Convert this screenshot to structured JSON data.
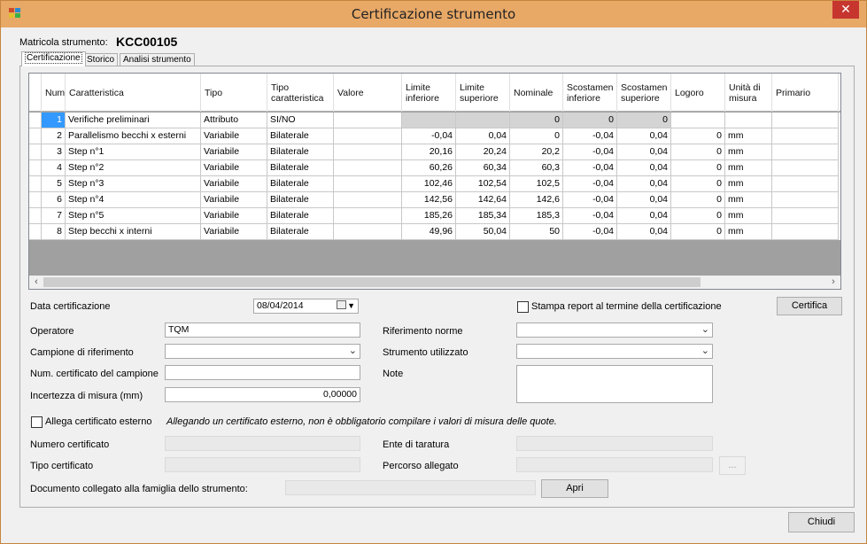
{
  "window": {
    "title": "Certificazione strumento",
    "close_glyph": "✕"
  },
  "matricola": {
    "label": "Matricola strumento:",
    "value": "KCC00105"
  },
  "tabs": [
    "Certificazione",
    "Storico",
    "Analisi strumento"
  ],
  "grid": {
    "headers": {
      "num": "Num",
      "caratteristica": "Caratteristica",
      "tipo": "Tipo",
      "tipo_caratteristica": "Tipo caratteristica",
      "valore": "Valore",
      "limite_inferiore": "Limite inferiore",
      "limite_superiore": "Limite superiore",
      "nominale": "Nominale",
      "scostamento_inferiore": "Scostamen inferiore",
      "scostamento_superiore": "Scostamen superiore",
      "logoro": "Logoro",
      "unita_misura": "Unità di misura",
      "primario": "Primario"
    },
    "rows": [
      {
        "num": "1",
        "caratteristica": "Verifiche preliminari",
        "tipo": "Attributo",
        "tipo_caratteristica": "SI/NO",
        "valore": "",
        "limite_inferiore": "",
        "limite_superiore": "",
        "nominale": "0",
        "scostamento_inferiore": "0",
        "scostamento_superiore": "0",
        "logoro": "",
        "unita_misura": "",
        "primario": ""
      },
      {
        "num": "2",
        "caratteristica": "Parallelismo becchi x esterni",
        "tipo": "Variabile",
        "tipo_caratteristica": "Bilaterale",
        "valore": "",
        "limite_inferiore": "-0,04",
        "limite_superiore": "0,04",
        "nominale": "0",
        "scostamento_inferiore": "-0,04",
        "scostamento_superiore": "0,04",
        "logoro": "0",
        "unita_misura": "mm",
        "primario": ""
      },
      {
        "num": "3",
        "caratteristica": "Step n°1",
        "tipo": "Variabile",
        "tipo_caratteristica": "Bilaterale",
        "valore": "",
        "limite_inferiore": "20,16",
        "limite_superiore": "20,24",
        "nominale": "20,2",
        "scostamento_inferiore": "-0,04",
        "scostamento_superiore": "0,04",
        "logoro": "0",
        "unita_misura": "mm",
        "primario": ""
      },
      {
        "num": "4",
        "caratteristica": "Step n°2",
        "tipo": "Variabile",
        "tipo_caratteristica": "Bilaterale",
        "valore": "",
        "limite_inferiore": "60,26",
        "limite_superiore": "60,34",
        "nominale": "60,3",
        "scostamento_inferiore": "-0,04",
        "scostamento_superiore": "0,04",
        "logoro": "0",
        "unita_misura": "mm",
        "primario": ""
      },
      {
        "num": "5",
        "caratteristica": "Step n°3",
        "tipo": "Variabile",
        "tipo_caratteristica": "Bilaterale",
        "valore": "",
        "limite_inferiore": "102,46",
        "limite_superiore": "102,54",
        "nominale": "102,5",
        "scostamento_inferiore": "-0,04",
        "scostamento_superiore": "0,04",
        "logoro": "0",
        "unita_misura": "mm",
        "primario": ""
      },
      {
        "num": "6",
        "caratteristica": "Step n°4",
        "tipo": "Variabile",
        "tipo_caratteristica": "Bilaterale",
        "valore": "",
        "limite_inferiore": "142,56",
        "limite_superiore": "142,64",
        "nominale": "142,6",
        "scostamento_inferiore": "-0,04",
        "scostamento_superiore": "0,04",
        "logoro": "0",
        "unita_misura": "mm",
        "primario": ""
      },
      {
        "num": "7",
        "caratteristica": "Step n°5",
        "tipo": "Variabile",
        "tipo_caratteristica": "Bilaterale",
        "valore": "",
        "limite_inferiore": "185,26",
        "limite_superiore": "185,34",
        "nominale": "185,3",
        "scostamento_inferiore": "-0,04",
        "scostamento_superiore": "0,04",
        "logoro": "0",
        "unita_misura": "mm",
        "primario": ""
      },
      {
        "num": "8",
        "caratteristica": "Step becchi x interni",
        "tipo": "Variabile",
        "tipo_caratteristica": "Bilaterale",
        "valore": "",
        "limite_inferiore": "49,96",
        "limite_superiore": "50,04",
        "nominale": "50",
        "scostamento_inferiore": "-0,04",
        "scostamento_superiore": "0,04",
        "logoro": "0",
        "unita_misura": "mm",
        "primario": ""
      }
    ]
  },
  "form": {
    "data_certificazione": {
      "label": "Data certificazione",
      "value": "08/04/2014"
    },
    "stampa_report": {
      "label": "Stampa report al termine della certificazione",
      "checked": false
    },
    "certifica_button": "Certifica",
    "operatore": {
      "label": "Operatore",
      "value": "TQM"
    },
    "riferimento_norme": {
      "label": "Riferimento norme",
      "value": ""
    },
    "campione_riferimento": {
      "label": "Campione di riferimento",
      "value": ""
    },
    "strumento_utilizzato": {
      "label": "Strumento utilizzato",
      "value": ""
    },
    "num_certificato_campione": {
      "label": "Num. certificato del campione",
      "value": ""
    },
    "note": {
      "label": "Note",
      "value": ""
    },
    "incertezza": {
      "label": "Incertezza di misura (mm)",
      "value": "0,00000"
    },
    "allega": {
      "label": "Allega certificato esterno",
      "checked": false,
      "note": "Allegando un certificato esterno, non è obbligatorio compilare i valori di misura delle quote."
    },
    "numero_certificato": {
      "label": "Numero certificato",
      "value": ""
    },
    "ente_taratura": {
      "label": "Ente di taratura",
      "value": ""
    },
    "tipo_certificato": {
      "label": "Tipo certificato",
      "value": ""
    },
    "percorso_allegato": {
      "label": "Percorso allegato",
      "value": "",
      "browse_label": "..."
    },
    "documento_collegato": {
      "label": "Documento collegato alla famiglia dello strumento:",
      "value": ""
    },
    "apri_button": "Apri"
  },
  "chiudi_button": "Chiudi",
  "icons": {
    "combo_chevron": "chevron-down-icon",
    "scroll_left": "chevron-left-icon",
    "scroll_right": "chevron-right-icon",
    "calendar": "calendar-icon"
  }
}
